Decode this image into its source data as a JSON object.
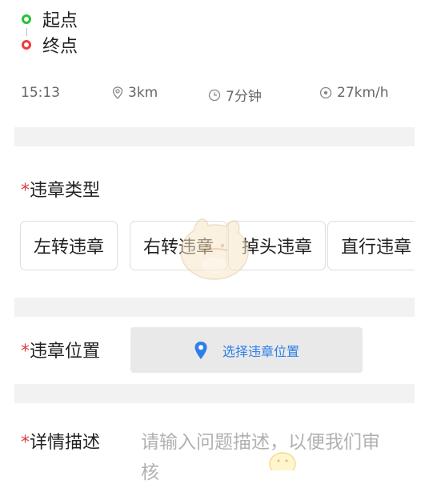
{
  "route": {
    "start_label": "起点",
    "end_label": "终点"
  },
  "stats": {
    "time": "15:13",
    "distance": "3km",
    "duration": "7分钟",
    "speed": "27km/h"
  },
  "violation_type": {
    "required_mark": "*",
    "title": "违章类型",
    "options": [
      "左转违章",
      "右转违章",
      "掉头违章",
      "直行违章"
    ]
  },
  "violation_location": {
    "required_mark": "*",
    "title": "违章位置",
    "button_label": "选择违章位置"
  },
  "details": {
    "required_mark": "*",
    "title": "详情描述",
    "placeholder_line1": "请输入问题描述，以便我们审",
    "placeholder_line2": "核"
  },
  "colors": {
    "start_dot": "#27c23a",
    "end_dot": "#f03b3b",
    "required": "#e23b3b",
    "location_blue": "#2d7fe8",
    "divider": "#f2f2f2"
  },
  "icons": {
    "start": "start-point-icon",
    "end": "end-point-icon",
    "distance": "location-pin-icon",
    "duration": "clock-icon",
    "speed": "speed-icon",
    "location_button": "map-pin-icon"
  }
}
